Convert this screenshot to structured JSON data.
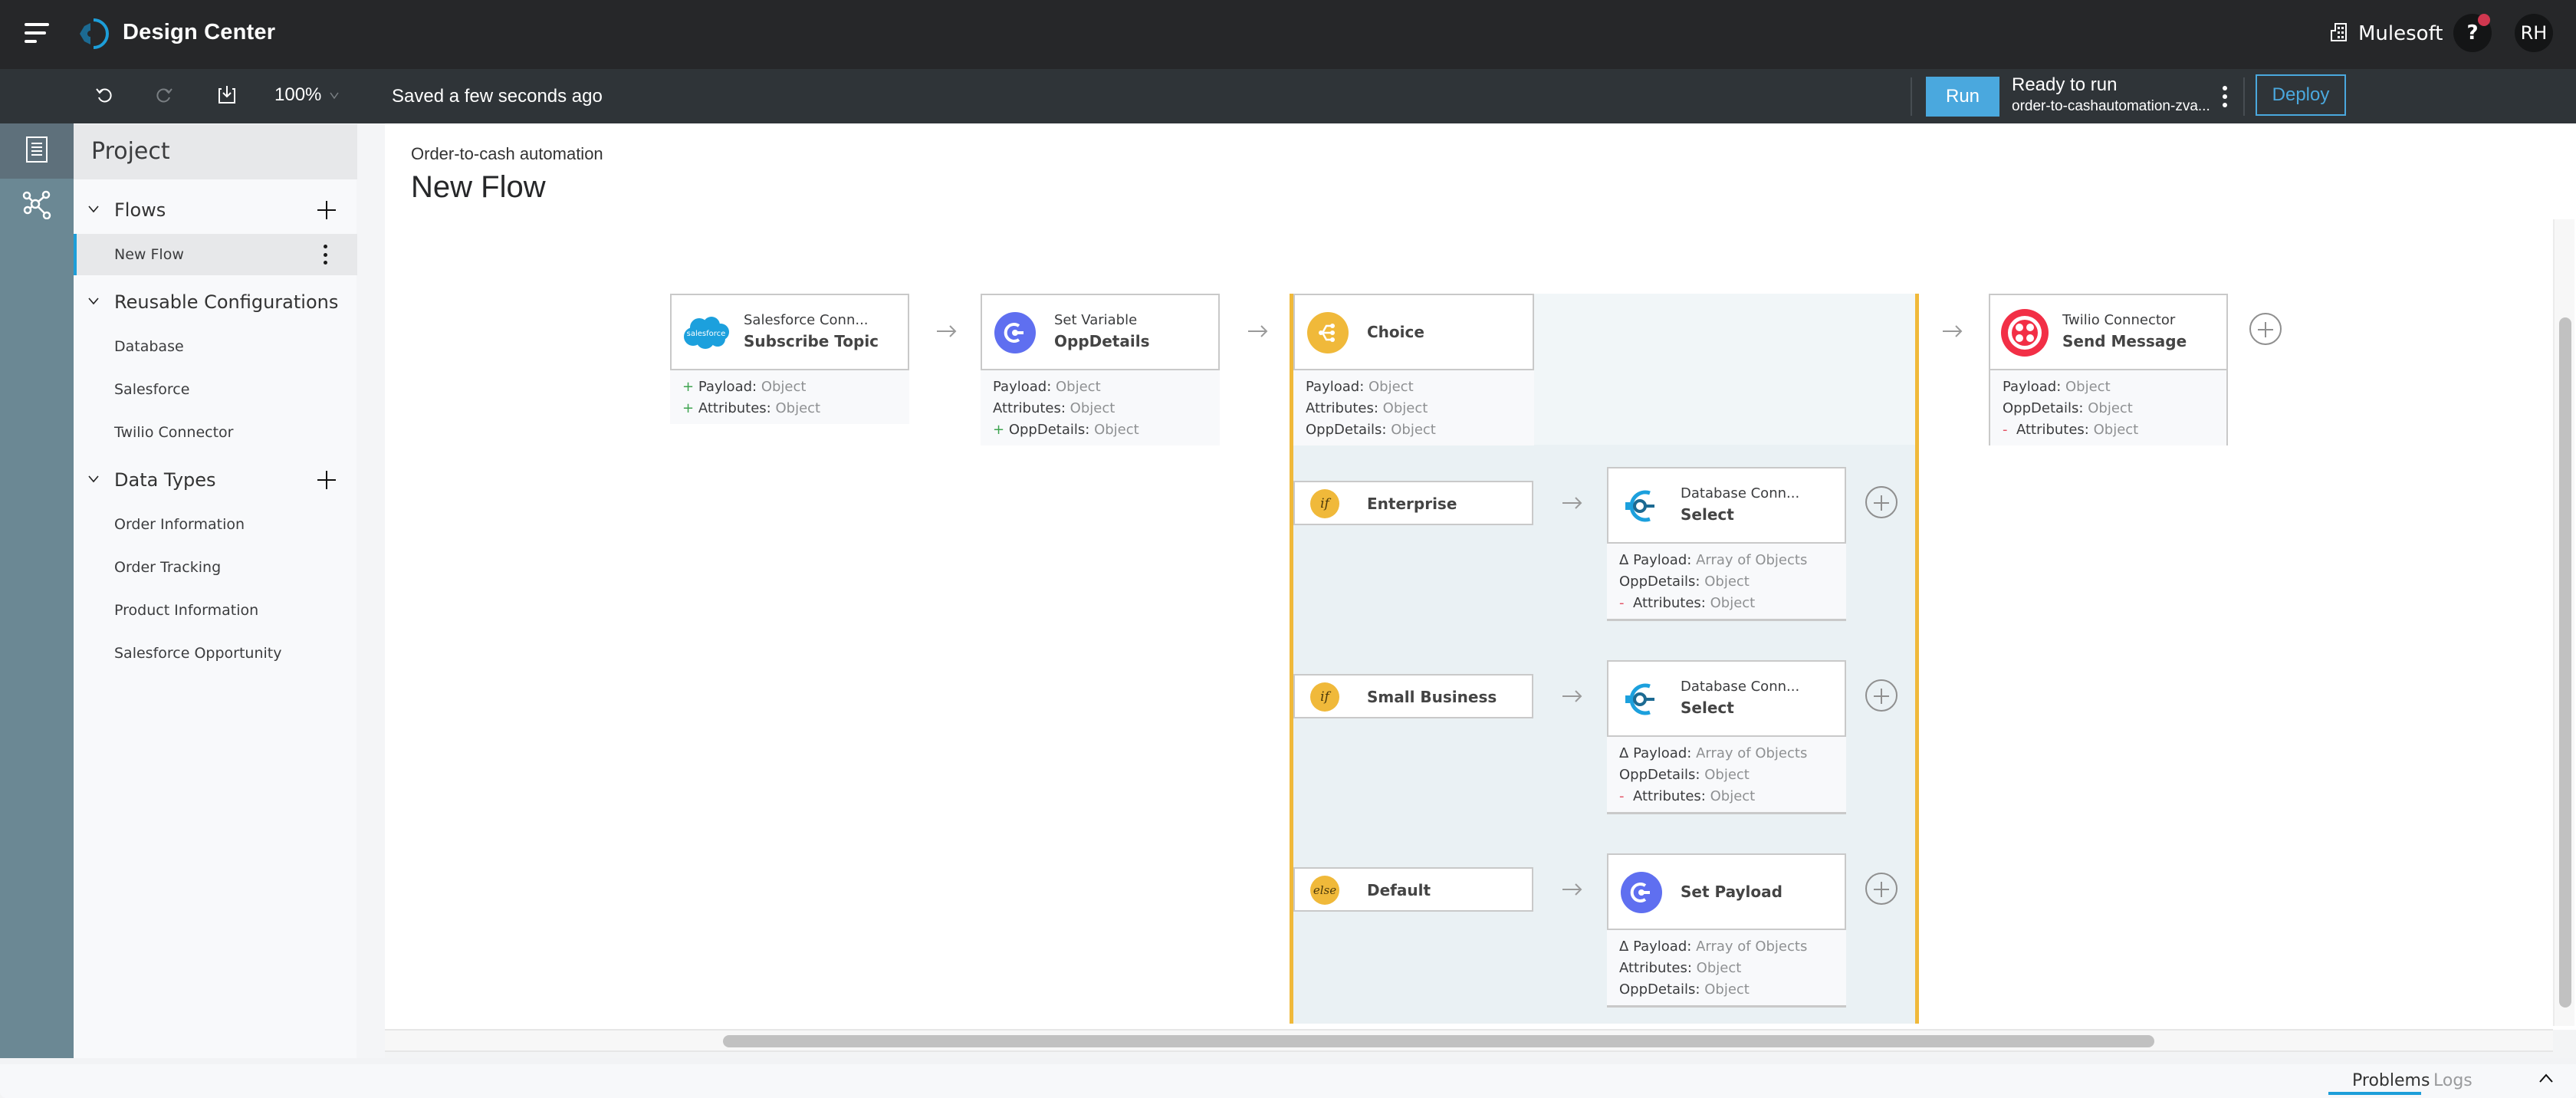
{
  "app": {
    "title": "Design Center",
    "org_name": "Mulesoft",
    "help_label": "?",
    "avatar_initials": "RH",
    "colors": {
      "accent": "#4aa8de",
      "choice": "#f0b93a",
      "notification": "#d0374f"
    }
  },
  "toolbar": {
    "undo_icon": "undo-icon",
    "redo_icon": "redo-icon",
    "download_icon": "download-icon",
    "zoom_level": "100%",
    "save_status": "Saved a few seconds ago",
    "run_label": "Run",
    "run_status": "Ready to run",
    "run_target": "order-to-cashautomation-zva...",
    "deploy_label": "Deploy"
  },
  "sidebar": {
    "title": "Project",
    "sections": [
      {
        "label": "Flows",
        "has_add": true,
        "items": [
          {
            "label": "New Flow",
            "active": true
          }
        ]
      },
      {
        "label": "Reusable Configurations",
        "has_add": false,
        "items": [
          {
            "label": "Database"
          },
          {
            "label": "Salesforce"
          },
          {
            "label": "Twilio Connector"
          }
        ]
      },
      {
        "label": "Data Types",
        "has_add": true,
        "items": [
          {
            "label": "Order Information"
          },
          {
            "label": "Order Tracking"
          },
          {
            "label": "Product Information"
          },
          {
            "label": "Salesforce Opportunity"
          }
        ]
      }
    ]
  },
  "canvas": {
    "breadcrumb": "Order-to-cash automation",
    "flow_title": "New Flow",
    "nodes": {
      "salesforce": {
        "type": "Salesforce Conn...",
        "action": "Subscribe Topic",
        "icon_text": "salesforce",
        "meta": [
          {
            "mark": "+",
            "key": "Payload:",
            "val": "Object"
          },
          {
            "mark": "+",
            "key": "Attributes:",
            "val": "Object"
          }
        ]
      },
      "setvar": {
        "type": "Set Variable",
        "action": "OppDetails",
        "meta": [
          {
            "mark": "",
            "key": "Payload:",
            "val": "Object"
          },
          {
            "mark": "",
            "key": "Attributes:",
            "val": "Object"
          },
          {
            "mark": "+",
            "key": "OppDetails:",
            "val": "Object"
          }
        ]
      },
      "choice": {
        "action": "Choice",
        "meta": [
          {
            "mark": "",
            "key": "Payload:",
            "val": "Object"
          },
          {
            "mark": "",
            "key": "Attributes:",
            "val": "Object"
          },
          {
            "mark": "",
            "key": "OppDetails:",
            "val": "Object"
          }
        ]
      },
      "twilio": {
        "type": "Twilio Connector",
        "action": "Send Message",
        "meta": [
          {
            "mark": "",
            "key": "Payload:",
            "val": "Object"
          },
          {
            "mark": "",
            "key": "OppDetails:",
            "val": "Object"
          },
          {
            "mark": "-",
            "key": "Attributes:",
            "val": "Object"
          }
        ]
      }
    },
    "branches": [
      {
        "condition_icon": "if",
        "label": "Enterprise",
        "node": {
          "type": "Database Conn...",
          "action": "Select",
          "meta": [
            {
              "mark": "Δ",
              "key": "Payload:",
              "val": "Array of Objects"
            },
            {
              "mark": "",
              "key": "OppDetails:",
              "val": "Object"
            },
            {
              "mark": "-",
              "key": "Attributes:",
              "val": "Object"
            }
          ]
        }
      },
      {
        "condition_icon": "if",
        "label": "Small Business",
        "node": {
          "type": "Database Conn...",
          "action": "Select",
          "meta": [
            {
              "mark": "Δ",
              "key": "Payload:",
              "val": "Array of Objects"
            },
            {
              "mark": "",
              "key": "OppDetails:",
              "val": "Object"
            },
            {
              "mark": "-",
              "key": "Attributes:",
              "val": "Object"
            }
          ]
        }
      },
      {
        "condition_icon": "else",
        "label": "Default",
        "node": {
          "type": "",
          "action": "Set Payload",
          "meta": [
            {
              "mark": "Δ",
              "key": "Payload:",
              "val": "Array of Objects"
            },
            {
              "mark": "",
              "key": "Attributes:",
              "val": "Object"
            },
            {
              "mark": "",
              "key": "OppDetails:",
              "val": "Object"
            }
          ]
        }
      }
    ]
  },
  "bottom_panel": {
    "tabs": [
      {
        "label": "Problems",
        "active": true
      },
      {
        "label": "Logs",
        "active": false
      }
    ]
  }
}
